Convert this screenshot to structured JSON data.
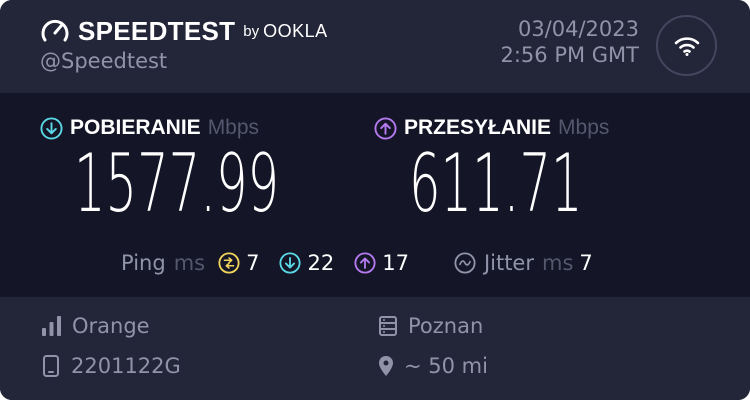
{
  "header": {
    "brand": "SPEEDTEST",
    "by": "by",
    "partner": "OOKLA",
    "handle": "@Speedtest",
    "date": "03/04/2023",
    "time": "2:56 PM GMT",
    "wifi_icon": "wifi-icon"
  },
  "download": {
    "label": "POBIERANIE",
    "unit": "Mbps",
    "value": "1577.99",
    "color": "#5ad8e6"
  },
  "upload": {
    "label": "PRZESYŁANIE",
    "unit": "Mbps",
    "value": "611.71",
    "color": "#b57af0"
  },
  "ping": {
    "label": "Ping",
    "unit": "ms",
    "idle": "7",
    "download": "22",
    "upload": "17",
    "idle_color": "#f1d45c"
  },
  "jitter": {
    "label": "Jitter",
    "unit": "ms",
    "value": "7"
  },
  "footer": {
    "isp": "Orange",
    "device": "2201122G",
    "server": "Poznan",
    "distance": "~ 50 mi"
  },
  "colors": {
    "panel": "#232538",
    "background": "#141526",
    "muted": "#9193a8",
    "unit": "#54576d"
  }
}
